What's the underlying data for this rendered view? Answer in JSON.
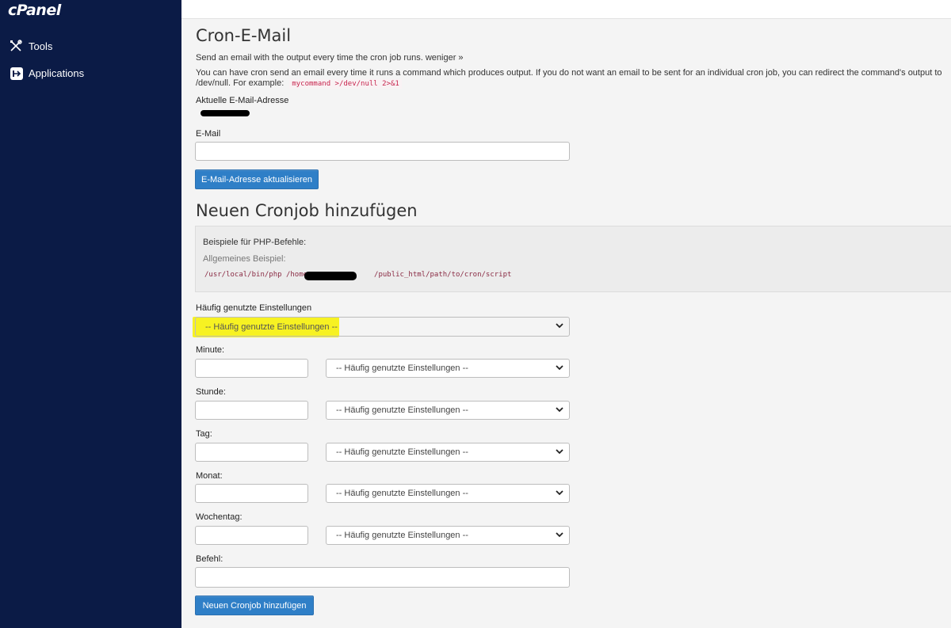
{
  "sidebar": {
    "logo": "cPanel",
    "items": [
      {
        "label": "Tools",
        "icon": "tools-icon"
      },
      {
        "label": "Applications",
        "icon": "applications-icon"
      }
    ]
  },
  "email_section": {
    "title": "Cron-E-Mail",
    "description": "Send an email with the output every time the cron job runs.",
    "toggle_link": "weniger »",
    "details": "You can have cron send an email every time it runs a command which produces output. If you do not want an email to be sent for an individual cron job, you can redirect the command's output to /dev/null. For example:",
    "example_code": "mycommand >/dev/null 2>&1",
    "current_email_label": "Aktuelle E-Mail-Adresse",
    "email_label": "E-Mail",
    "email_value": "",
    "update_button": "E-Mail-Adresse aktualisieren"
  },
  "add_section": {
    "title": "Neuen Cronjob hinzufügen",
    "examples_title": "Beispiele für PHP-Befehle:",
    "examples_sub": "Allgemeines Beispiel:",
    "example_cmd_start": "/usr/local/bin/php /home",
    "example_cmd_end": "/public_html/path/to/cron/script",
    "common_label": "Häufig genutzte Einstellungen",
    "common_select": "-- Häufig genutzte Einstellungen --",
    "rows": [
      {
        "label": "Minute:",
        "value": "",
        "select": "-- Häufig genutzte Einstellungen --"
      },
      {
        "label": "Stunde:",
        "value": "",
        "select": "-- Häufig genutzte Einstellungen --"
      },
      {
        "label": "Tag:",
        "value": "",
        "select": "-- Häufig genutzte Einstellungen --"
      },
      {
        "label": "Monat:",
        "value": "",
        "select": "-- Häufig genutzte Einstellungen --"
      },
      {
        "label": "Wochentag:",
        "value": "",
        "select": "-- Häufig genutzte Einstellungen --"
      }
    ],
    "command_label": "Befehl:",
    "command_value": "",
    "add_button": "Neuen Cronjob hinzufügen"
  },
  "colors": {
    "sidebar_bg": "#0b1b46",
    "button_bg": "#2f7fc7",
    "highlight": "#f7f222"
  }
}
